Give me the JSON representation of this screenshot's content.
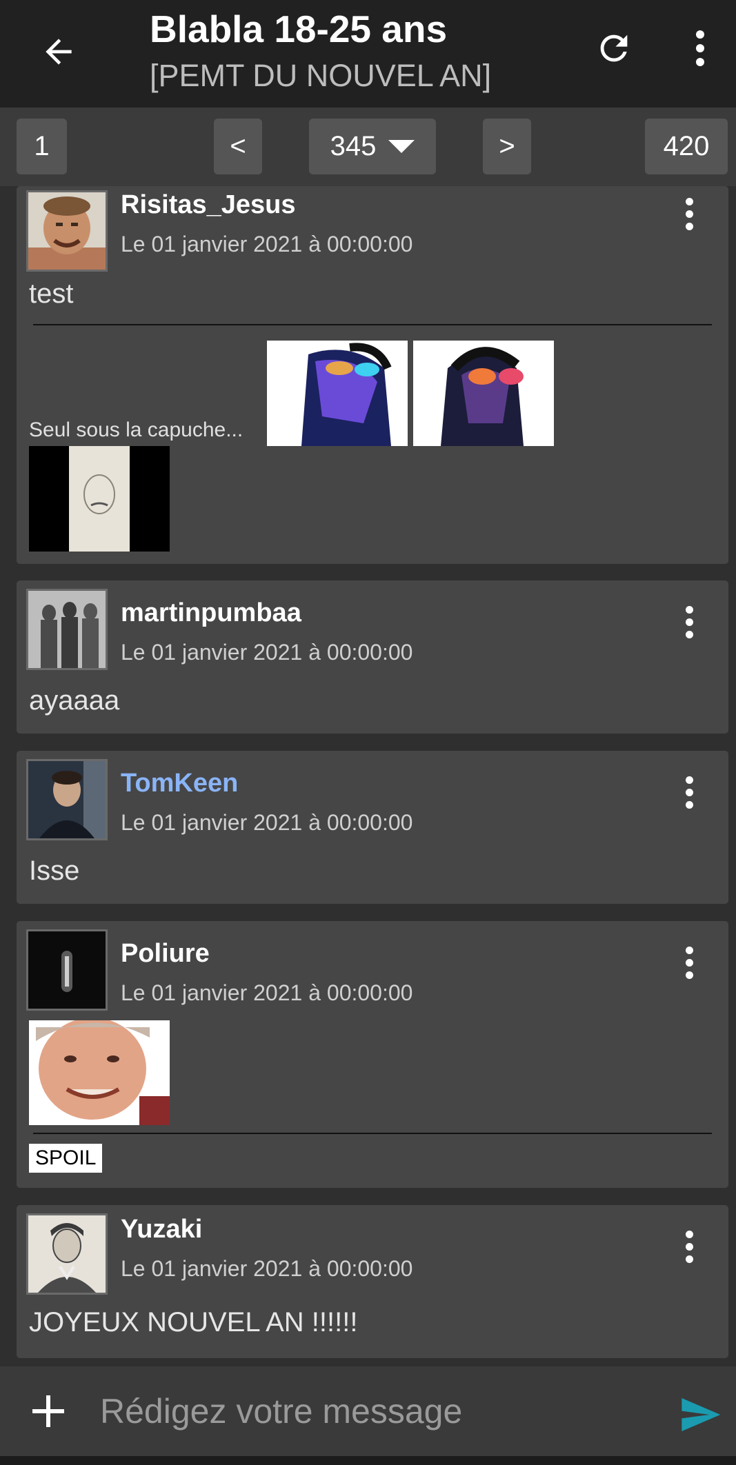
{
  "header": {
    "title": "Blabla 18-25 ans",
    "subtitle": "[PEMT DU NOUVEL AN]",
    "icons": {
      "back": "arrow-back-icon",
      "refresh": "refresh-icon",
      "menu": "more-vert-icon"
    }
  },
  "pager": {
    "first": "1",
    "prev": "<",
    "current": "345",
    "next": ">",
    "last": "420"
  },
  "messages": [
    {
      "author": "Risitas_Jesus",
      "date": "Le 01 janvier 2021 à 00:00:00",
      "text": "test",
      "signature_text": "Seul sous la capuche..."
    },
    {
      "author": "martinpumbaa",
      "date": "Le 01 janvier 2021 à 00:00:00",
      "text": "ayaaaa"
    },
    {
      "author": "TomKeen",
      "author_color": "#8ab4f8",
      "date": "Le 01 janvier 2021 à 00:00:00",
      "text": "Isse"
    },
    {
      "author": "Poliure",
      "date": "Le 01 janvier 2021 à 00:00:00",
      "signature_text": "SPOIL"
    },
    {
      "author": "Yuzaki",
      "date": "Le 01 janvier 2021 à 00:00:00",
      "text": "JOYEUX NOUVEL AN !!!!!!"
    }
  ],
  "composer": {
    "placeholder": "Rédigez votre message",
    "icons": {
      "add": "plus-icon",
      "send": "send-icon"
    },
    "send_color": "#1a9bb0"
  }
}
